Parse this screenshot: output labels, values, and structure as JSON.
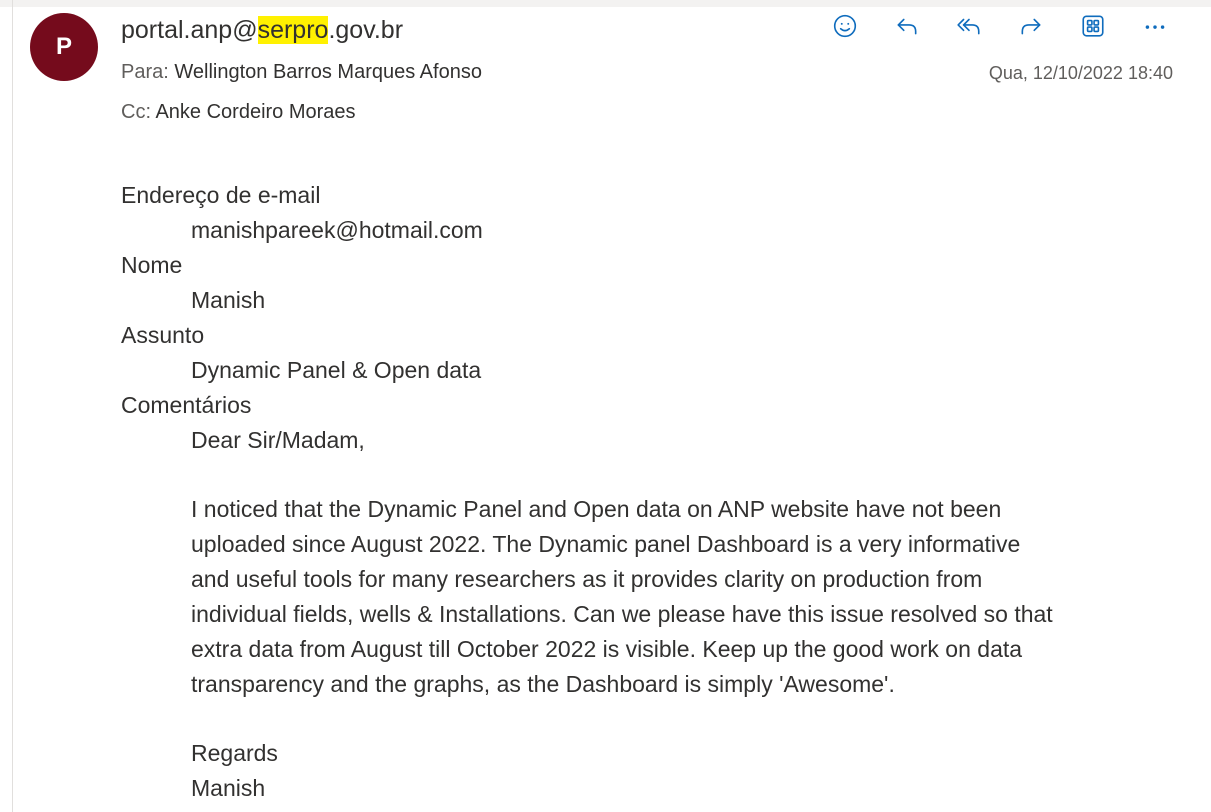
{
  "message": {
    "avatar_initial": "P",
    "sender": {
      "before": "portal.anp@",
      "highlight": "serpro",
      "after": ".gov.br"
    },
    "to_label": "Para:",
    "to_value": "Wellington Barros Marques Afonso",
    "cc_label": "Cc:",
    "cc_value": "Anke Cordeiro Moraes",
    "date": "Qua, 12/10/2022 18:40"
  },
  "toolbar": {
    "icons": [
      "emoji-icon",
      "reply-icon",
      "reply-all-icon",
      "forward-icon",
      "apps-icon",
      "more-icon"
    ]
  },
  "body": {
    "email_label": "Endereço de e-mail",
    "email_value": "manishpareek@hotmail.com",
    "name_label": "Nome",
    "name_value": "Manish",
    "subject_label": "Assunto",
    "subject_value": "Dynamic Panel & Open data",
    "comments_label": "Comentários",
    "greeting": "Dear Sir/Madam,",
    "lines": [
      "I noticed that the Dynamic Panel and Open data on ANP website have not been",
      "uploaded since August 2022. The Dynamic panel Dashboard is a very informative",
      "and useful tools for many researchers as it provides clarity on production from",
      "individual fields, wells & Installations. Can we please have this issue resolved so that",
      "extra data from August till October 2022 is visible. Keep up the good work on data",
      "transparency and the graphs, as the Dashboard is simply 'Awesome'."
    ],
    "regards": "Regards",
    "signature": "Manish"
  },
  "colors": {
    "accent": "#0f6cbd",
    "avatar": "#750b1c",
    "highlight": "#fff100"
  }
}
